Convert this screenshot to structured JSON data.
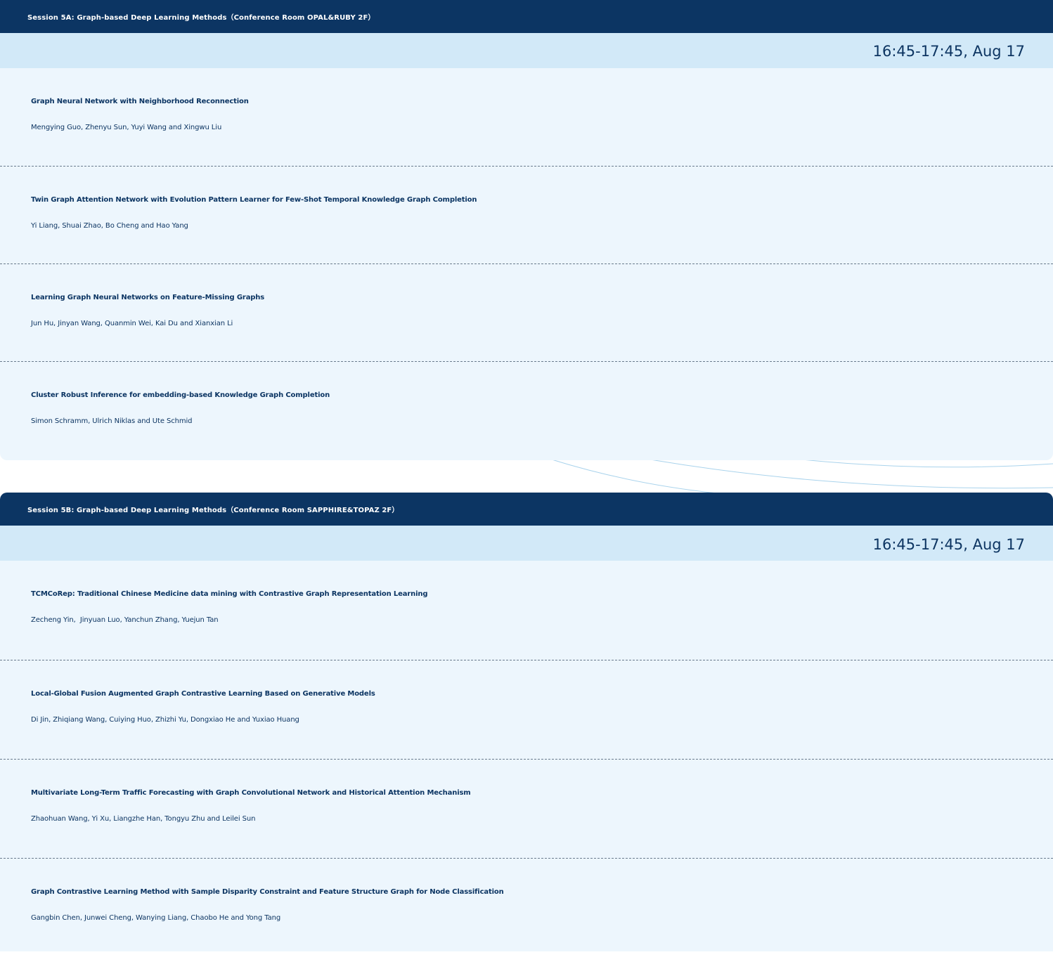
{
  "sessions": [
    {
      "title": "Session 5A: Graph-based Deep Learning Methods（Conference Room OPAL&RUBY 2F）",
      "time": "16:45-17:45, Aug 17",
      "papers": [
        {
          "title": "Graph Neural Network with Neighborhood Reconnection",
          "authors": "Mengying Guo, Zhenyu Sun, Yuyi Wang and Xingwu Liu"
        },
        {
          "title": "Twin Graph Attention Network with Evolution Pattern Learner for Few-Shot Temporal Knowledge Graph Completion",
          "authors": "Yi Liang, Shuai Zhao, Bo Cheng and Hao Yang"
        },
        {
          "title": "Learning Graph Neural Networks on Feature-Missing Graphs",
          "authors": "Jun Hu, Jinyan Wang, Quanmin Wei, Kai Du and Xianxian Li"
        },
        {
          "title": "Cluster Robust Inference for embedding-based Knowledge Graph Completion",
          "authors": "Simon Schramm, Ulrich Niklas and Ute Schmid"
        }
      ]
    },
    {
      "title": "Session 5B: Graph-based Deep Learning Methods（Conference Room SAPPHIRE&TOPAZ 2F）",
      "time": "16:45-17:45, Aug 17",
      "papers": [
        {
          "title": "TCMCoRep: Traditional Chinese Medicine data mining with Contrastive Graph Representation Learning",
          "authors": "Zecheng Yin,  Jinyuan Luo, Yanchun Zhang, Yuejun Tan"
        },
        {
          "title": "Local-Global Fusion Augmented Graph Contrastive Learning Based on Generative Models",
          "authors": "Di Jin, Zhiqiang Wang, Cuiying Huo, Zhizhi Yu, Dongxiao He and Yuxiao Huang"
        },
        {
          "title": "Multivariate Long-Term Traffic Forecasting with Graph Convolutional Network and Historical Attention Mechanism",
          "authors": "Zhaohuan Wang, Yi Xu, Liangzhe Han, Tongyu Zhu and Leilei Sun"
        },
        {
          "title": "Graph Contrastive Learning Method with Sample Disparity Constraint and Feature Structure Graph for Node Classification",
          "authors": "Gangbin Chen, Junwei Cheng, Wanying Liang, Chaobo He and Yong Tang"
        }
      ]
    }
  ],
  "colors": {
    "header_bg": "#0c3563",
    "time_bar_bg": "#d2e9f8",
    "panel_bg": "#edf6fd",
    "text": "#0d3562",
    "divider": "#6a7b8d",
    "decor_curve": "#a9d3ec"
  }
}
